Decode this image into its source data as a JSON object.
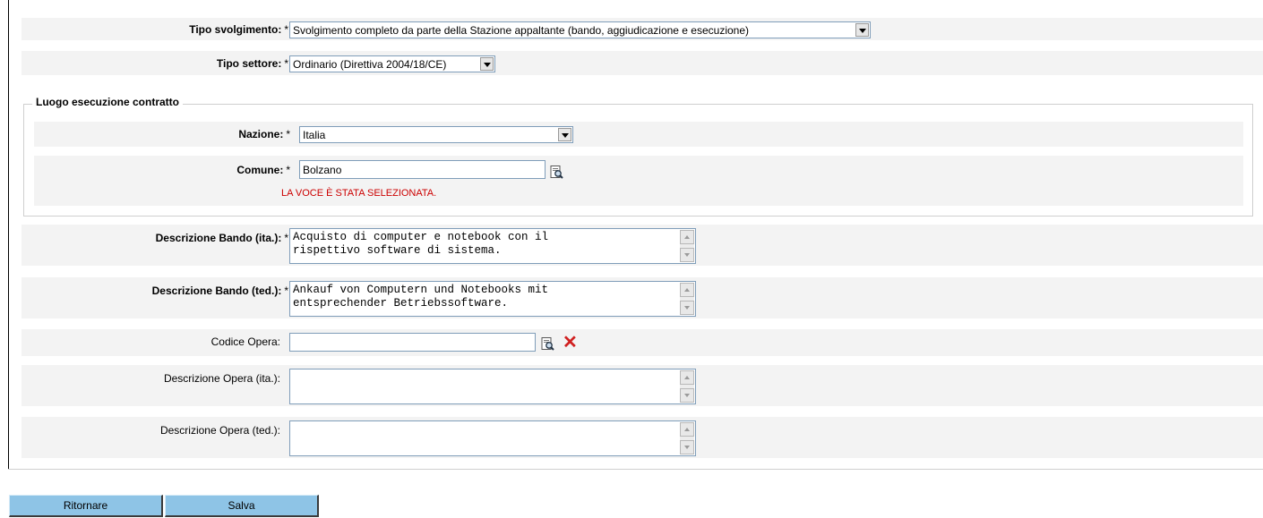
{
  "form": {
    "tipo_svolgimento": {
      "label": "Tipo svolgimento:",
      "required": "*",
      "value": "Svolgimento completo da parte della Stazione appaltante (bando, aggiudicazione e esecuzione)"
    },
    "tipo_settore": {
      "label": "Tipo settore:",
      "required": "*",
      "value": "Ordinario (Direttiva 2004/18/CE)"
    },
    "luogo": {
      "legend": "Luogo esecuzione contratto",
      "nazione": {
        "label": "Nazione:",
        "required": "*",
        "value": "Italia"
      },
      "comune": {
        "label": "Comune:",
        "required": "*",
        "value": "Bolzano",
        "message": "LA VOCE È STATA SELEZIONATA."
      }
    },
    "descrizione_bando_ita": {
      "label": "Descrizione Bando (ita.):",
      "required": "*",
      "value": "Acquisto di computer e notebook con il\nrispettivo software di sistema."
    },
    "descrizione_bando_ted": {
      "label": "Descrizione Bando (ted.):",
      "required": "*",
      "value": "Ankauf von Computern und Notebooks mit\nentsprechender Betriebssoftware."
    },
    "codice_opera": {
      "label": "Codice Opera:",
      "value": ""
    },
    "descrizione_opera_ita": {
      "label": "Descrizione Opera (ita.):",
      "value": ""
    },
    "descrizione_opera_ted": {
      "label": "Descrizione Opera (ted.):",
      "value": ""
    }
  },
  "buttons": {
    "back": "Ritornare",
    "save": "Salva"
  },
  "colors": {
    "row_bg": "#f3f3f3",
    "message": "#cc0000",
    "button_bg": "#8ec4e6",
    "clear_icon": "#d02020"
  },
  "icons": {
    "lookup": "search-document-icon",
    "clear": "clear-x-icon"
  }
}
